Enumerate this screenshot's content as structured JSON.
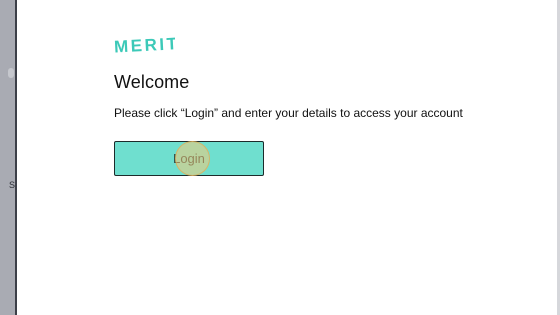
{
  "brand": {
    "logo_text": "MERIT",
    "accent_color": "#3cc9b8"
  },
  "modal": {
    "title": "Welcome",
    "instructions": "Please click “Login” and enter your details to access your account",
    "login_label": "Login",
    "login_color": "#6fdfcf"
  },
  "backdrop": {
    "peek_text": "S"
  }
}
